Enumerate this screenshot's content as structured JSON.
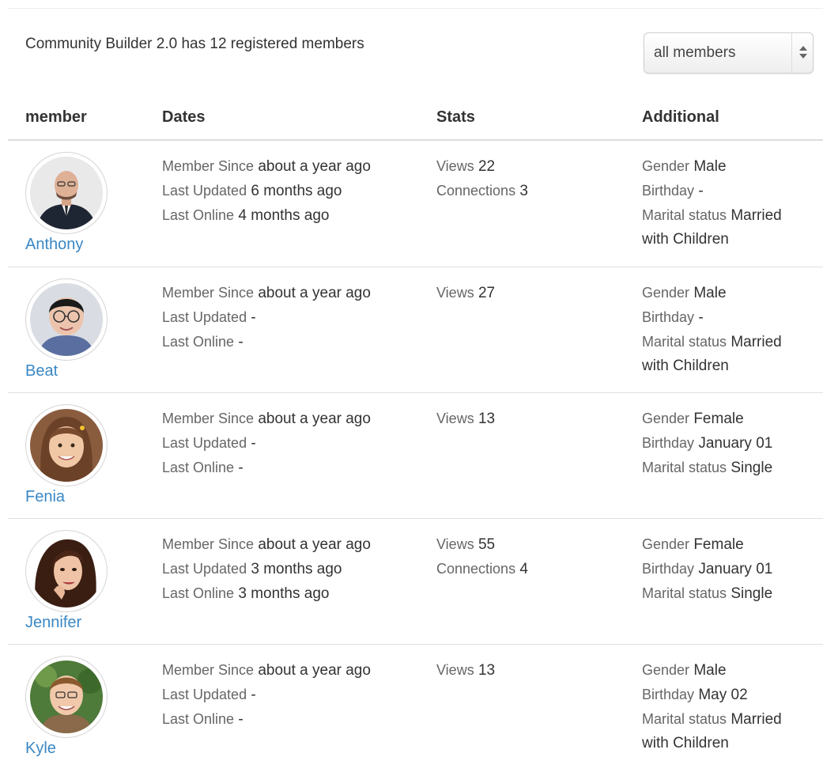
{
  "summary": "Community Builder 2.0 has 12 registered members",
  "filter": {
    "selected": "all members"
  },
  "table": {
    "headers": {
      "member": "member",
      "dates": "Dates",
      "stats": "Stats",
      "additional": "Additional"
    }
  },
  "labels": {
    "member_since": "Member Since",
    "last_updated": "Last Updated",
    "last_online": "Last Online",
    "views": "Views",
    "connections": "Connections",
    "gender": "Gender",
    "birthday": "Birthday",
    "marital_status": "Marital status"
  },
  "members": [
    {
      "name": "Anthony",
      "member_since": "about a year ago",
      "last_updated": "6 months ago",
      "last_online": "4 months ago",
      "views": "22",
      "connections": "3",
      "gender": "Male",
      "birthday": "-",
      "marital_status": "Married with Children"
    },
    {
      "name": "Beat",
      "member_since": "about a year ago",
      "last_updated": "-",
      "last_online": "-",
      "views": "27",
      "gender": "Male",
      "birthday": "-",
      "marital_status": "Married with Children"
    },
    {
      "name": "Fenia",
      "member_since": "about a year ago",
      "last_updated": "-",
      "last_online": "-",
      "views": "13",
      "gender": "Female",
      "birthday": "January 01",
      "marital_status": "Single"
    },
    {
      "name": "Jennifer",
      "member_since": "about a year ago",
      "last_updated": "3 months ago",
      "last_online": "3 months ago",
      "views": "55",
      "connections": "4",
      "gender": "Female",
      "birthday": "January 01",
      "marital_status": "Single"
    },
    {
      "name": "Kyle",
      "member_since": "about a year ago",
      "last_updated": "-",
      "last_online": "-",
      "views": "13",
      "gender": "Male",
      "birthday": "May 02",
      "marital_status": "Married with Children"
    }
  ],
  "colors": {
    "link": "#3a87c4",
    "text": "#333333",
    "label": "#666666",
    "rule": "#e0e0e0"
  }
}
